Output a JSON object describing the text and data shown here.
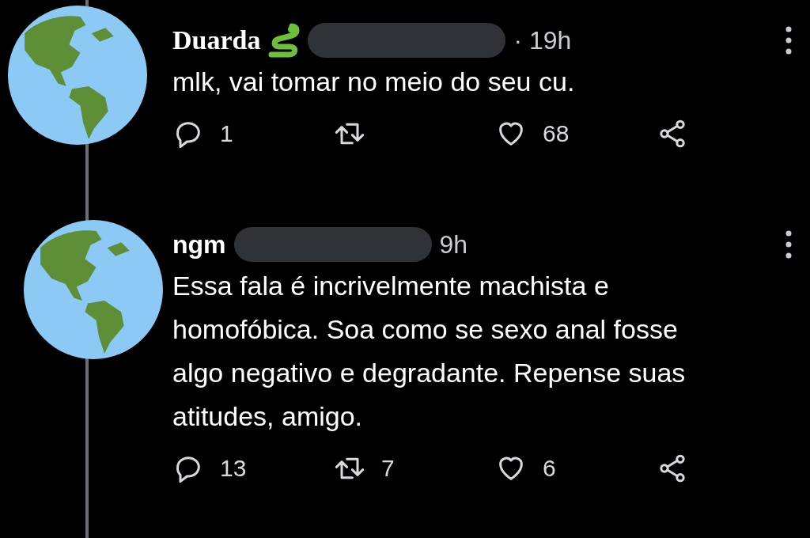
{
  "tweets": [
    {
      "kind": "blackletter",
      "name": "Duarda",
      "time": "· 19h",
      "text": "mlk, vai tomar no meio do seu cu.",
      "replies": "1",
      "likes": "68"
    },
    {
      "kind": "plain",
      "name": "ngm",
      "time": "9h",
      "text": "Essa fala é incrivelmente machista e homofóbica. Soa como se sexo anal fosse algo negativo e degradante. Repense suas atitudes, amigo.",
      "replies": "13",
      "retweets": "7",
      "likes": "6"
    }
  ]
}
